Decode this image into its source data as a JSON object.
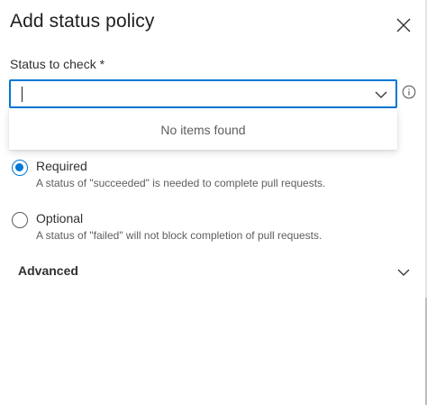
{
  "panel": {
    "title": "Add status policy",
    "close_icon": "close-icon"
  },
  "status_field": {
    "label": "Status to check *",
    "value": "",
    "chevron_icon": "chevron-down-icon",
    "info_icon": "info-icon",
    "dropdown_message": "No items found"
  },
  "requirement": {
    "options": [
      {
        "label": "Required",
        "description": "A status of \"succeeded\" is needed to complete pull requests.",
        "selected": true
      },
      {
        "label": "Optional",
        "description": "A status of \"failed\" will not block completion of pull requests.",
        "selected": false
      }
    ]
  },
  "advanced": {
    "label": "Advanced",
    "chevron_icon": "chevron-down-icon"
  },
  "colors": {
    "accent": "#0078d4",
    "text": "#323130",
    "secondary_text": "#605e5c"
  }
}
